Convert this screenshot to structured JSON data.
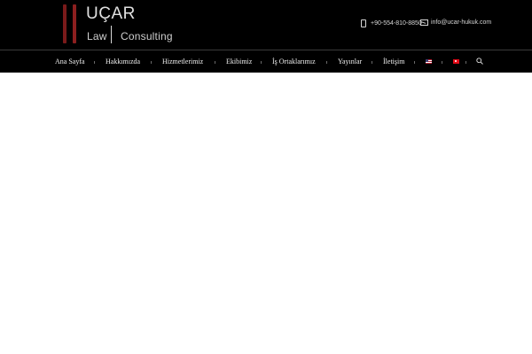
{
  "brand": {
    "name": "UÇAR",
    "tagline_left": "Law",
    "tagline_right": "Consulting",
    "accent_color": "#8c1f1f"
  },
  "contact": {
    "phone": "+90-554-810-8850",
    "email": "info@ucar-hukuk.com",
    "phone_icon": "phone-icon",
    "email_icon": "mail-icon"
  },
  "nav": {
    "items": [
      {
        "label": "Ana Sayfa"
      },
      {
        "label": "Hakkımızda"
      },
      {
        "label": "Hizmetlerimiz"
      },
      {
        "label": "Ekibimiz"
      },
      {
        "label": "İş Ortaklarımız"
      },
      {
        "label": "Yayınlar"
      },
      {
        "label": "İletişim"
      }
    ],
    "languages": [
      {
        "code": "en",
        "icon": "us-flag-icon"
      },
      {
        "code": "tr",
        "icon": "tr-flag-icon"
      }
    ],
    "search_icon": "search-icon"
  },
  "colors": {
    "header_bg": "#000000",
    "text": "#f0f0f0",
    "page_bg": "#ffffff"
  }
}
